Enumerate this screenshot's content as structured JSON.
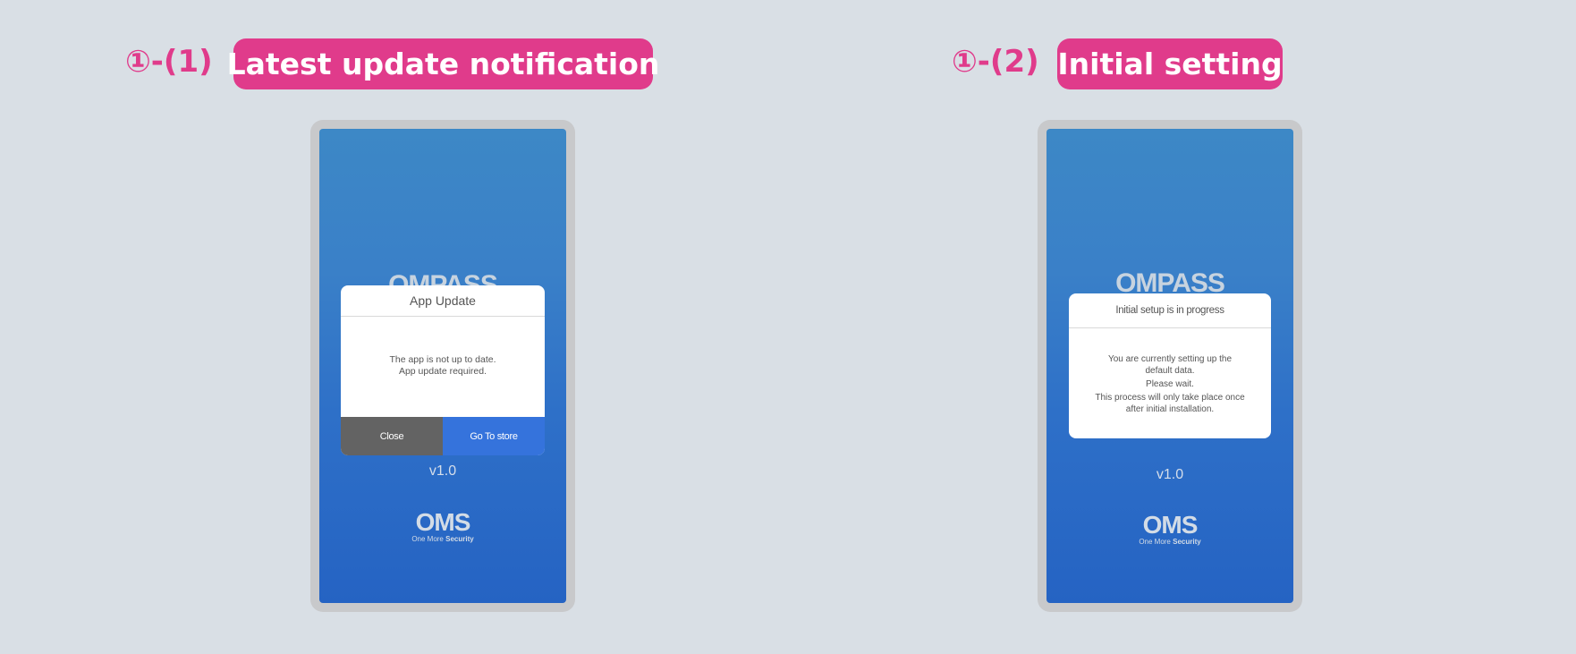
{
  "panels": [
    {
      "step": "①-(1)",
      "title": "Latest update notification",
      "brand": "OMPASS",
      "version": "v1.0",
      "logo": {
        "mark": "OMS",
        "tagline_prefix": "One More ",
        "tagline_strong": "Security"
      },
      "dialog": {
        "title": "App Update",
        "lines": [
          "The app is not up to date.",
          "App update required."
        ],
        "buttons": {
          "close": "Close",
          "store": "Go To store"
        }
      }
    },
    {
      "step": "①-(2)",
      "title": "Initial setting",
      "brand": "OMPASS",
      "version": "v1.0",
      "logo": {
        "mark": "OMS",
        "tagline_prefix": "One More ",
        "tagline_strong": "Security"
      },
      "dialog": {
        "title": "Initial setup is in progress",
        "lines": [
          "You are currently setting up the",
          "default data.",
          "Please wait.",
          "This process will only take place once",
          "after initial installation."
        ]
      }
    }
  ],
  "colors": {
    "accent": "#e03b8b",
    "background": "#d9dfe5",
    "screen_top": "#3d88c6",
    "screen_bottom": "#2563c3",
    "button_close": "#636363",
    "button_store": "#3573dc"
  }
}
